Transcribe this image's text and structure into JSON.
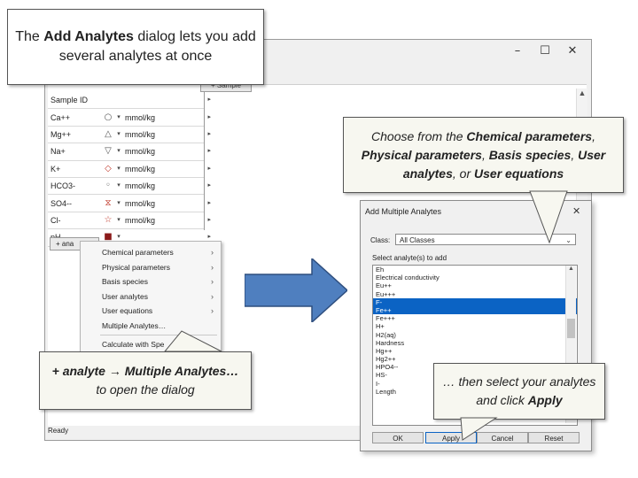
{
  "callouts": {
    "top": {
      "pre": "The ",
      "bold": "Add Analytes",
      "post": " dialog lets you add several analytes at once"
    },
    "mid": {
      "p1": "Choose from the ",
      "b1": "Chemical parameters",
      "p2": ", ",
      "b2": "Physical parameters",
      "p3": ", ",
      "b3": "Basis species",
      "p4": ", ",
      "b4": "User analytes",
      "p5": ", or ",
      "b5": "User equations"
    },
    "left": {
      "bold": "+ analyte → Multiple Analytes…",
      "post": " to open the dialog"
    },
    "right": {
      "pre": "… then select your analytes and click ",
      "bold": "Apply"
    }
  },
  "main_window": {
    "controls": {
      "minimize": "–",
      "maximize": "☐",
      "close": "✕"
    },
    "sample_tab": "+ Sample",
    "add_tab": "+ ana",
    "status": "Ready",
    "grid_header": "Sample ID",
    "grid_rows": [
      {
        "name": "Ca++",
        "symbol": "○",
        "unit": "mmol/kg",
        "color": "#555555"
      },
      {
        "name": "Mg++",
        "symbol": "△",
        "unit": "mmol/kg",
        "color": "#555555"
      },
      {
        "name": "Na+",
        "symbol": "▽",
        "unit": "mmol/kg",
        "color": "#555555"
      },
      {
        "name": "K+",
        "symbol": "◇",
        "unit": "mmol/kg",
        "color": "#c0392b"
      },
      {
        "name": "HCO3-",
        "symbol": "◦",
        "unit": "mmol/kg",
        "color": "#555555"
      },
      {
        "name": "SO4--",
        "symbol": "⧖",
        "unit": "mmol/kg",
        "color": "#c0392b"
      },
      {
        "name": "Cl-",
        "symbol": "☆",
        "unit": "mmol/kg",
        "color": "#c0392b"
      },
      {
        "name": "pH",
        "symbol": "■",
        "unit": "",
        "color": "#8b1a1a"
      }
    ]
  },
  "context_menu": {
    "items": [
      {
        "label": "Chemical parameters",
        "submenu": true
      },
      {
        "label": "Physical parameters",
        "submenu": true
      },
      {
        "label": "Basis species",
        "submenu": true
      },
      {
        "label": "User analytes",
        "submenu": true
      },
      {
        "label": "User equations",
        "submenu": true
      },
      {
        "label": "Multiple Analytes…",
        "submenu": false
      }
    ],
    "after_separator": "Calculate with Spe"
  },
  "dialog": {
    "title": "Add Multiple Analytes",
    "close": "✕",
    "class_label": "Class:",
    "class_value": "All Classes",
    "list_label": "Select analyte(s) to add",
    "list_items": [
      {
        "label": "Eh",
        "selected": false
      },
      {
        "label": "Electrical conductivity",
        "selected": false
      },
      {
        "label": "Eu++",
        "selected": false
      },
      {
        "label": "Eu+++",
        "selected": false
      },
      {
        "label": "F-",
        "selected": true
      },
      {
        "label": "Fe++",
        "selected": true
      },
      {
        "label": "Fe+++",
        "selected": false
      },
      {
        "label": "H+",
        "selected": false
      },
      {
        "label": "H2(aq)",
        "selected": false
      },
      {
        "label": "Hardness",
        "selected": false
      },
      {
        "label": "Hg++",
        "selected": false
      },
      {
        "label": "Hg2++",
        "selected": false
      },
      {
        "label": "HPO4--",
        "selected": false
      },
      {
        "label": "HS-",
        "selected": false
      },
      {
        "label": "I-",
        "selected": false
      },
      {
        "label": "Length",
        "selected": false
      }
    ],
    "buttons": {
      "ok": "OK",
      "apply": "Apply",
      "cancel": "Cancel",
      "reset": "Reset"
    }
  },
  "colors": {
    "arrow": "#4f7fbf",
    "selection": "#0b63c4"
  }
}
